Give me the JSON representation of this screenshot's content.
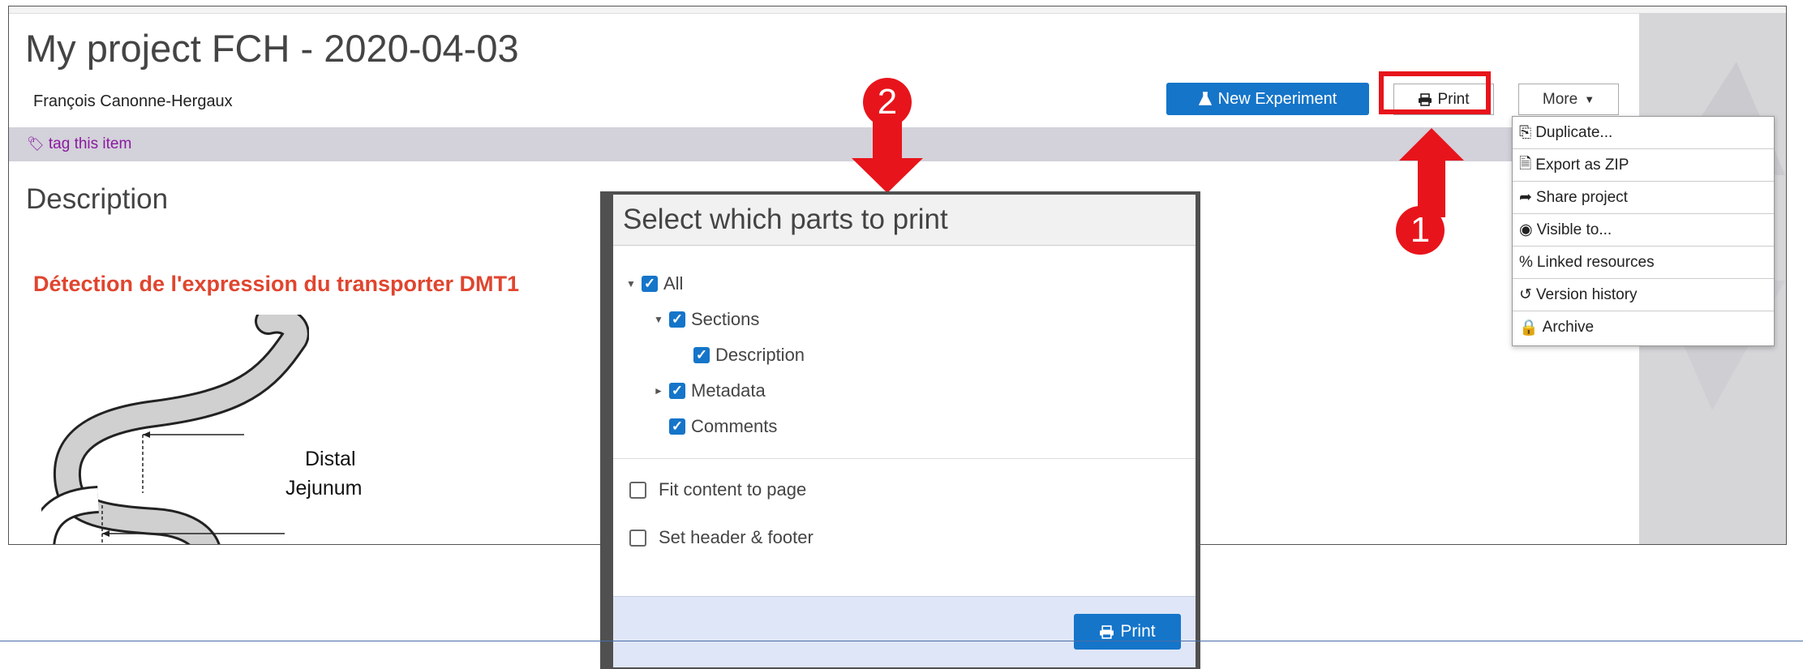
{
  "project": {
    "title": "My project FCH - 2020-04-03",
    "author": "François Canonne-Hergaux",
    "tag_link": "tag this item"
  },
  "toolbar": {
    "new_experiment_label": "New Experiment",
    "print_label": "Print",
    "more_label": "More"
  },
  "more_menu": {
    "items": [
      {
        "label": "Duplicate...",
        "icon": "duplicate-icon"
      },
      {
        "label": "Export as ZIP",
        "icon": "zip-icon"
      },
      {
        "label": "Share project",
        "icon": "share-icon"
      },
      {
        "label": "Visible to...",
        "icon": "eye-icon"
      },
      {
        "label": "Linked resources",
        "icon": "link-icon"
      },
      {
        "label": "Version history",
        "icon": "history-icon"
      },
      {
        "label": "Archive",
        "icon": "lock-icon"
      }
    ]
  },
  "content": {
    "section_heading": "Description",
    "red_heading": "Détection de l'expression du transporter DMT1",
    "figure_label_distal": "Distal",
    "figure_label_jejunum": "Jejunum"
  },
  "annotations": {
    "step1": "1",
    "step2": "2",
    "color": "#e8141b"
  },
  "print_dialog": {
    "title": "Select which parts to print",
    "tree": [
      {
        "label": "All",
        "checked": true
      },
      {
        "label": "Sections",
        "checked": true
      },
      {
        "label": "Description",
        "checked": true
      },
      {
        "label": "Metadata",
        "checked": true
      },
      {
        "label": "Comments",
        "checked": true
      }
    ],
    "options": [
      {
        "label": "Fit content to page",
        "checked": false
      },
      {
        "label": "Set header & footer",
        "checked": false
      }
    ],
    "print_button": "Print"
  },
  "colors": {
    "accent": "#1575c9",
    "tag": "#8a1aa0",
    "heading_red": "#e0452f"
  }
}
